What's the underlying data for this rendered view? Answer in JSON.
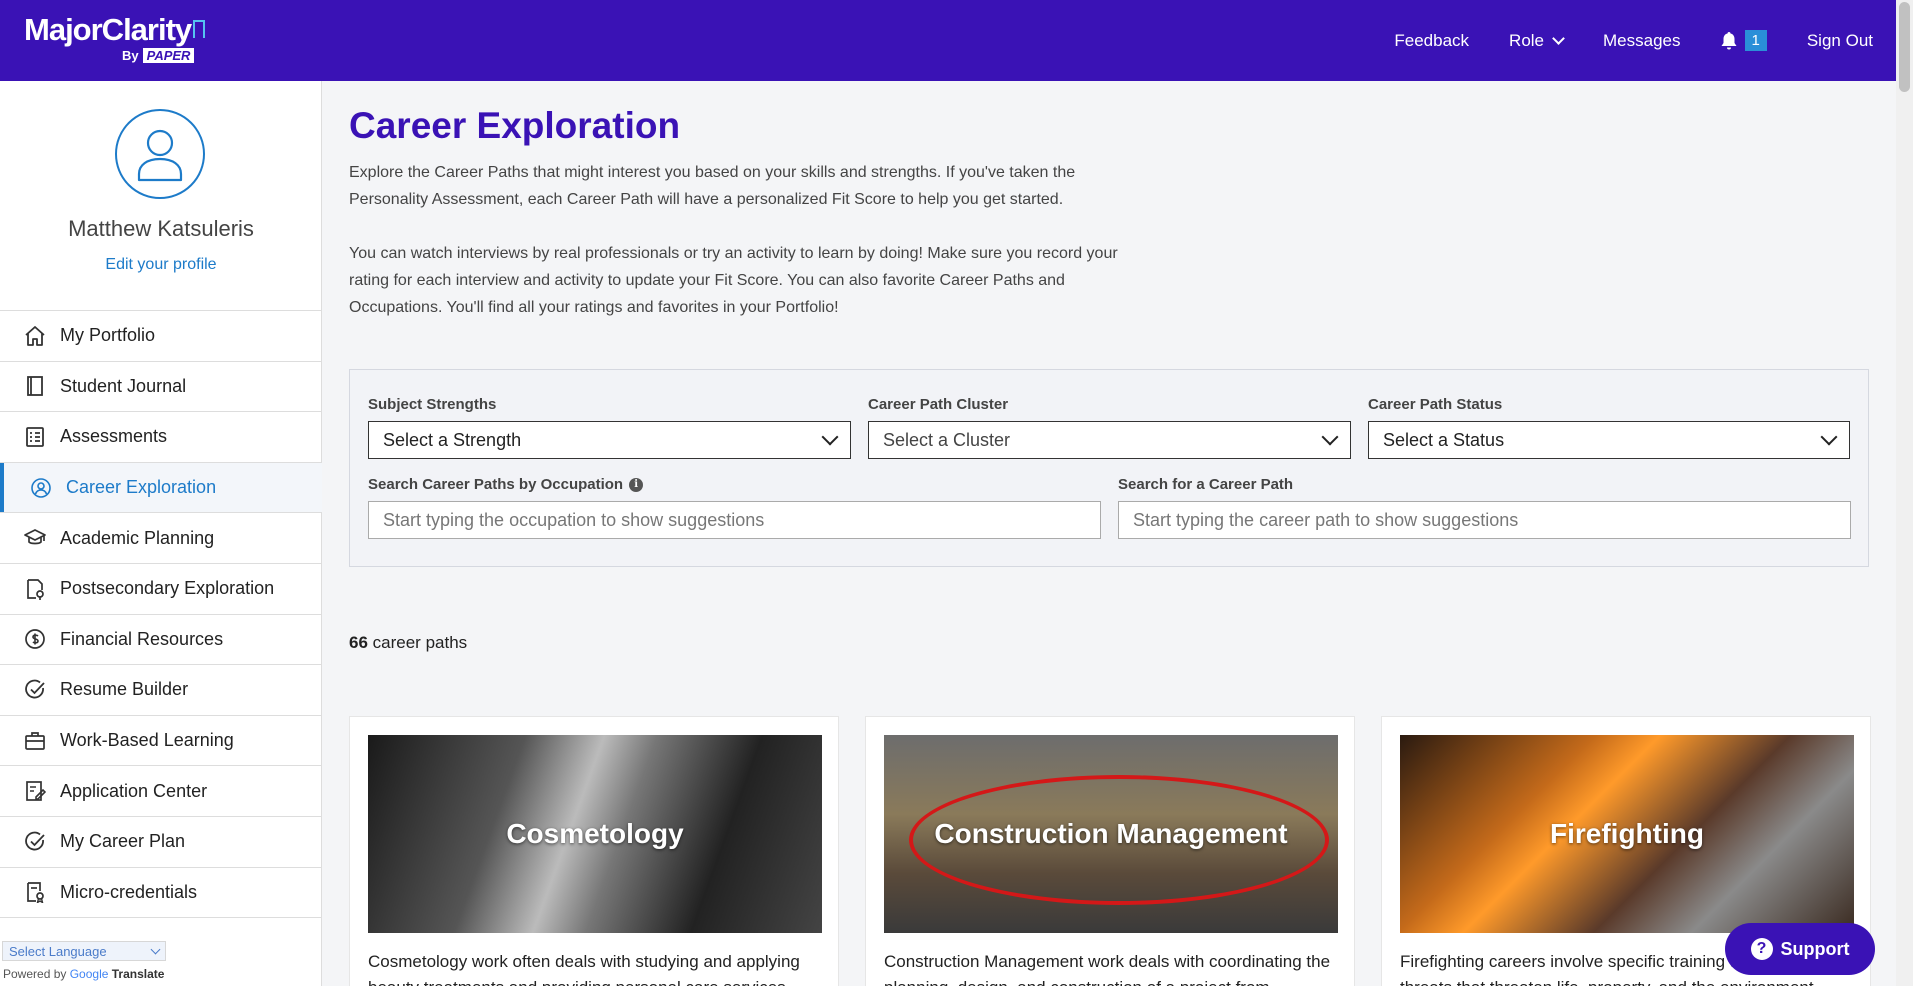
{
  "header": {
    "logo_main": "MajorClarity",
    "logo_by": "By",
    "logo_paper": "PAPER",
    "nav": {
      "feedback": "Feedback",
      "role": "Role",
      "messages": "Messages",
      "notification_count": "1",
      "sign_out": "Sign Out"
    }
  },
  "sidebar": {
    "profile_name": "Matthew Katsuleris",
    "edit_profile": "Edit your profile",
    "items": [
      {
        "label": "My Portfolio",
        "icon": "home-icon"
      },
      {
        "label": "Student Journal",
        "icon": "journal-icon"
      },
      {
        "label": "Assessments",
        "icon": "assessment-icon"
      },
      {
        "label": "Career Exploration",
        "icon": "career-icon",
        "active": true
      },
      {
        "label": "Academic Planning",
        "icon": "graduation-cap-icon"
      },
      {
        "label": "Postsecondary Exploration",
        "icon": "document-pin-icon"
      },
      {
        "label": "Financial Resources",
        "icon": "dollar-icon"
      },
      {
        "label": "Resume Builder",
        "icon": "check-circle-icon"
      },
      {
        "label": "Work-Based Learning",
        "icon": "briefcase-icon"
      },
      {
        "label": "Application Center",
        "icon": "application-icon"
      },
      {
        "label": "My Career Plan",
        "icon": "check-circle-icon"
      },
      {
        "label": "Micro-credentials",
        "icon": "credential-icon"
      }
    ],
    "language_select": "Select Language",
    "powered_by": "Powered by",
    "google": "Google",
    "translate": "Translate"
  },
  "main": {
    "title": "Career Exploration",
    "intro_1": "Explore the Career Paths that might interest you based on your skills and strengths. If you've taken the Personality Assessment, each Career Path will have a personalized Fit Score to help you get started.",
    "intro_2": "You can watch interviews by real professionals or try an activity to learn by doing! Make sure you record your rating for each interview and activity to update your Fit Score. You can also favorite Career Paths and Occupations. You'll find all your ratings and favorites in your Portfolio!",
    "filters": {
      "subject_label": "Subject Strengths",
      "subject_value": "Select a Strength",
      "cluster_label": "Career Path Cluster",
      "cluster_value": "Select a Cluster",
      "status_label": "Career Path Status",
      "status_value": "Select a Status",
      "occupation_label": "Search Career Paths by Occupation",
      "occupation_placeholder": "Start typing the occupation to show suggestions",
      "path_label": "Search for a Career Path",
      "path_placeholder": "Start typing the career path to show suggestions"
    },
    "count_number": "66",
    "count_text": "career paths",
    "cards": [
      {
        "title": "Cosmetology",
        "desc": "Cosmetology work often deals with studying and applying beauty treatments and providing personal care services. This"
      },
      {
        "title": "Construction Management",
        "desc": "Construction Management work deals with coordinating the planning, design, and construction of a project from"
      },
      {
        "title": "Firefighting",
        "desc": "Firefighting careers involve specific training to handle threats that threaten life, property, and the environment. This could"
      }
    ]
  },
  "support": "Support"
}
